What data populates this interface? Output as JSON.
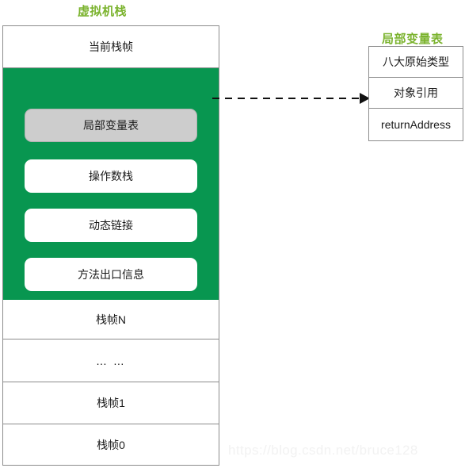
{
  "diagram": {
    "left_panel": {
      "title": "虚拟机栈",
      "title_color": "#7bb32e",
      "current_frame_label": "当前栈帧",
      "current_frame_block": {
        "background_color": "#089650",
        "items": [
          {
            "label": "局部变量表",
            "highlighted": true,
            "fill_color": "#cdcdcd"
          },
          {
            "label": "操作数栈",
            "highlighted": false,
            "fill_color": "#ffffff"
          },
          {
            "label": "动态链接",
            "highlighted": false,
            "fill_color": "#ffffff"
          },
          {
            "label": "方法出口信息",
            "highlighted": false,
            "fill_color": "#ffffff"
          }
        ]
      },
      "stack_rows": [
        {
          "label": "栈帧N"
        },
        {
          "label": "… …"
        },
        {
          "label": "栈帧1"
        },
        {
          "label": "栈帧0"
        }
      ]
    },
    "connector": {
      "style": "dashed-arrow",
      "from": "局部变量表",
      "to": "局部变量表"
    },
    "right_panel": {
      "title": "局部变量表",
      "title_color": "#7bb32e",
      "rows": [
        {
          "label": "八大原始类型"
        },
        {
          "label": "对象引用"
        },
        {
          "label": "returnAddress"
        }
      ]
    },
    "watermark": "https://blog.csdn.net/bruce128"
  }
}
